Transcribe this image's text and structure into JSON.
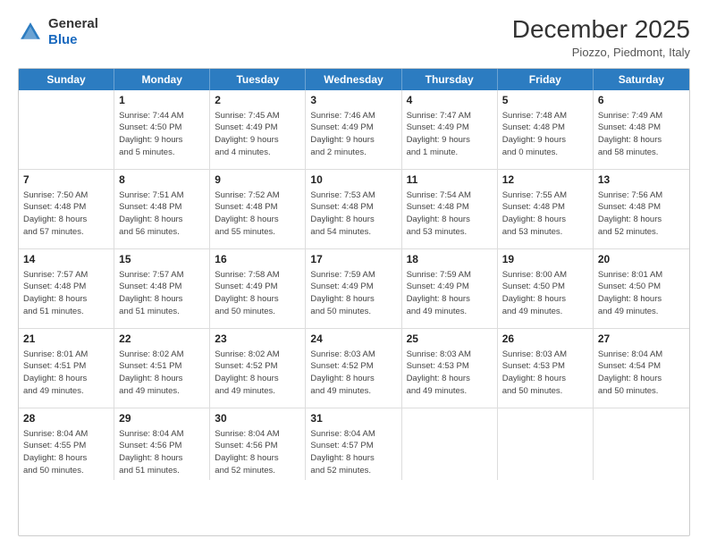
{
  "logo": {
    "line1": "General",
    "line2": "Blue"
  },
  "header": {
    "month": "December 2025",
    "location": "Piozzo, Piedmont, Italy"
  },
  "weekdays": [
    "Sunday",
    "Monday",
    "Tuesday",
    "Wednesday",
    "Thursday",
    "Friday",
    "Saturday"
  ],
  "weeks": [
    [
      {
        "day": "",
        "text": ""
      },
      {
        "day": "1",
        "text": "Sunrise: 7:44 AM\nSunset: 4:50 PM\nDaylight: 9 hours\nand 5 minutes."
      },
      {
        "day": "2",
        "text": "Sunrise: 7:45 AM\nSunset: 4:49 PM\nDaylight: 9 hours\nand 4 minutes."
      },
      {
        "day": "3",
        "text": "Sunrise: 7:46 AM\nSunset: 4:49 PM\nDaylight: 9 hours\nand 2 minutes."
      },
      {
        "day": "4",
        "text": "Sunrise: 7:47 AM\nSunset: 4:49 PM\nDaylight: 9 hours\nand 1 minute."
      },
      {
        "day": "5",
        "text": "Sunrise: 7:48 AM\nSunset: 4:48 PM\nDaylight: 9 hours\nand 0 minutes."
      },
      {
        "day": "6",
        "text": "Sunrise: 7:49 AM\nSunset: 4:48 PM\nDaylight: 8 hours\nand 58 minutes."
      }
    ],
    [
      {
        "day": "7",
        "text": "Sunrise: 7:50 AM\nSunset: 4:48 PM\nDaylight: 8 hours\nand 57 minutes."
      },
      {
        "day": "8",
        "text": "Sunrise: 7:51 AM\nSunset: 4:48 PM\nDaylight: 8 hours\nand 56 minutes."
      },
      {
        "day": "9",
        "text": "Sunrise: 7:52 AM\nSunset: 4:48 PM\nDaylight: 8 hours\nand 55 minutes."
      },
      {
        "day": "10",
        "text": "Sunrise: 7:53 AM\nSunset: 4:48 PM\nDaylight: 8 hours\nand 54 minutes."
      },
      {
        "day": "11",
        "text": "Sunrise: 7:54 AM\nSunset: 4:48 PM\nDaylight: 8 hours\nand 53 minutes."
      },
      {
        "day": "12",
        "text": "Sunrise: 7:55 AM\nSunset: 4:48 PM\nDaylight: 8 hours\nand 53 minutes."
      },
      {
        "day": "13",
        "text": "Sunrise: 7:56 AM\nSunset: 4:48 PM\nDaylight: 8 hours\nand 52 minutes."
      }
    ],
    [
      {
        "day": "14",
        "text": "Sunrise: 7:57 AM\nSunset: 4:48 PM\nDaylight: 8 hours\nand 51 minutes."
      },
      {
        "day": "15",
        "text": "Sunrise: 7:57 AM\nSunset: 4:48 PM\nDaylight: 8 hours\nand 51 minutes."
      },
      {
        "day": "16",
        "text": "Sunrise: 7:58 AM\nSunset: 4:49 PM\nDaylight: 8 hours\nand 50 minutes."
      },
      {
        "day": "17",
        "text": "Sunrise: 7:59 AM\nSunset: 4:49 PM\nDaylight: 8 hours\nand 50 minutes."
      },
      {
        "day": "18",
        "text": "Sunrise: 7:59 AM\nSunset: 4:49 PM\nDaylight: 8 hours\nand 49 minutes."
      },
      {
        "day": "19",
        "text": "Sunrise: 8:00 AM\nSunset: 4:50 PM\nDaylight: 8 hours\nand 49 minutes."
      },
      {
        "day": "20",
        "text": "Sunrise: 8:01 AM\nSunset: 4:50 PM\nDaylight: 8 hours\nand 49 minutes."
      }
    ],
    [
      {
        "day": "21",
        "text": "Sunrise: 8:01 AM\nSunset: 4:51 PM\nDaylight: 8 hours\nand 49 minutes."
      },
      {
        "day": "22",
        "text": "Sunrise: 8:02 AM\nSunset: 4:51 PM\nDaylight: 8 hours\nand 49 minutes."
      },
      {
        "day": "23",
        "text": "Sunrise: 8:02 AM\nSunset: 4:52 PM\nDaylight: 8 hours\nand 49 minutes."
      },
      {
        "day": "24",
        "text": "Sunrise: 8:03 AM\nSunset: 4:52 PM\nDaylight: 8 hours\nand 49 minutes."
      },
      {
        "day": "25",
        "text": "Sunrise: 8:03 AM\nSunset: 4:53 PM\nDaylight: 8 hours\nand 49 minutes."
      },
      {
        "day": "26",
        "text": "Sunrise: 8:03 AM\nSunset: 4:53 PM\nDaylight: 8 hours\nand 50 minutes."
      },
      {
        "day": "27",
        "text": "Sunrise: 8:04 AM\nSunset: 4:54 PM\nDaylight: 8 hours\nand 50 minutes."
      }
    ],
    [
      {
        "day": "28",
        "text": "Sunrise: 8:04 AM\nSunset: 4:55 PM\nDaylight: 8 hours\nand 50 minutes."
      },
      {
        "day": "29",
        "text": "Sunrise: 8:04 AM\nSunset: 4:56 PM\nDaylight: 8 hours\nand 51 minutes."
      },
      {
        "day": "30",
        "text": "Sunrise: 8:04 AM\nSunset: 4:56 PM\nDaylight: 8 hours\nand 52 minutes."
      },
      {
        "day": "31",
        "text": "Sunrise: 8:04 AM\nSunset: 4:57 PM\nDaylight: 8 hours\nand 52 minutes."
      },
      {
        "day": "",
        "text": ""
      },
      {
        "day": "",
        "text": ""
      },
      {
        "day": "",
        "text": ""
      }
    ]
  ]
}
